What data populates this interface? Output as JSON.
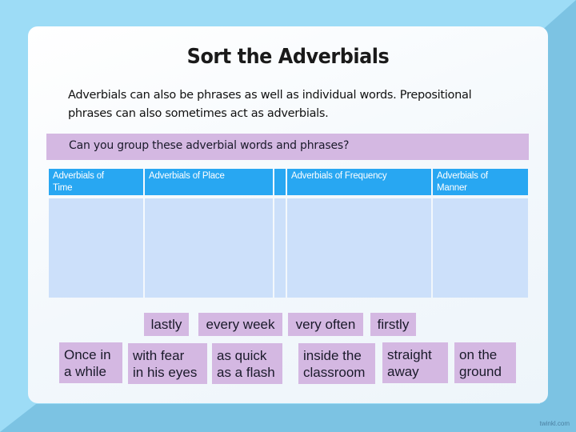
{
  "slide": {
    "title": "Sort the Adverbials",
    "intro_line1": "Adverbials can also be phrases as well as individual words.  Prepositional",
    "intro_line2": "phrases can also sometimes act as adverbials.",
    "prompt": "Can you group these adverbial words and phrases?"
  },
  "table": {
    "columns": [
      {
        "label_line1": "Adverbials of",
        "label_line2": "Time"
      },
      {
        "label_line1": "Adverbials of Place",
        "label_line2": ""
      },
      {
        "label_line1": "",
        "label_line2": ""
      },
      {
        "label_line1": "Adverbials of Frequency",
        "label_line2": ""
      },
      {
        "label_line1": "Adverbials of",
        "label_line2": "Manner"
      }
    ]
  },
  "cards": {
    "row1": [
      {
        "line1": "lastly"
      },
      {
        "line1": "every week"
      },
      {
        "line1": "very often"
      },
      {
        "line1": "firstly"
      }
    ],
    "row2": [
      {
        "line1": "Once in",
        "line2": "a while"
      },
      {
        "line1": "with fear",
        "line2": "in his eyes"
      },
      {
        "line1": "as quick",
        "line2": "as a flash"
      },
      {
        "line1": "inside the",
        "line2": "classroom"
      },
      {
        "line1": "straight",
        "line2": "away"
      },
      {
        "line1": "on the",
        "line2": "ground"
      }
    ]
  },
  "footer": {
    "watermark": "twinkl.com"
  },
  "colors": {
    "background": "#9ddcf6",
    "background_dark": "#7cc3e3",
    "header_blue": "#28a7f2",
    "cell_blue": "#cce0fa",
    "card_purple": "#d4b8e2"
  }
}
